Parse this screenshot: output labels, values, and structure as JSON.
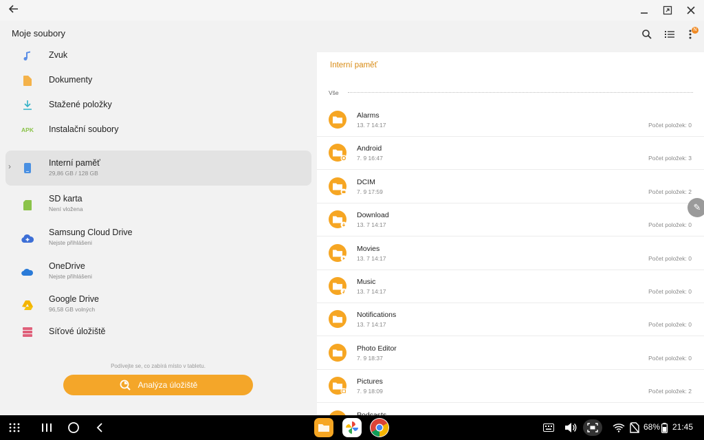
{
  "titlebar": {
    "back_icon": "arrow-left-icon",
    "minimize_icon": "minimize-icon",
    "resize_icon": "resize-icon",
    "close_icon": "close-icon"
  },
  "appbar": {
    "title": "Moje soubory",
    "badge": "N"
  },
  "sidebar": {
    "items": [
      {
        "label": "Zvuk",
        "sub": "",
        "icon": "music-note-icon",
        "color": "#5b8ee6"
      },
      {
        "label": "Dokumenty",
        "sub": "",
        "icon": "document-icon",
        "color": "#f4b24a"
      },
      {
        "label": "Stažené položky",
        "sub": "",
        "icon": "download-icon",
        "color": "#33b1c7"
      },
      {
        "label": "Instalační soubory",
        "sub": "",
        "icon": "apk-icon",
        "icon_text": "APK",
        "color": "#8bc34a"
      },
      {
        "label": "Interní paměť",
        "sub": "29,86 GB / 128 GB",
        "icon": "phone-icon",
        "color": "#4a90e2"
      },
      {
        "label": "SD karta",
        "sub": "Není vložena",
        "icon": "sd-card-icon",
        "color": "#8bc34a"
      },
      {
        "label": "Samsung Cloud Drive",
        "sub": "Nejste přihlášeni",
        "icon": "cloud-icon",
        "color": "#3d6fd6"
      },
      {
        "label": "OneDrive",
        "sub": "Nejste přihlášeni",
        "icon": "onedrive-icon",
        "color": "#2b7bd8"
      },
      {
        "label": "Google Drive",
        "sub": "96,58 GB volných",
        "icon": "google-drive-icon",
        "color": "#f4b400"
      },
      {
        "label": "Síťové úložiště",
        "sub": "",
        "icon": "server-icon",
        "color": "#e0607a"
      }
    ],
    "hint": "Podívejte se, co zabírá místo v tabletu.",
    "analyze_label": "Analýza úložiště"
  },
  "panel": {
    "title": "Interní paměť",
    "section": "Vše",
    "folders": [
      {
        "name": "Alarms",
        "date": "13. 7 14:17",
        "count": "Počet položek: 0",
        "overlay": ""
      },
      {
        "name": "Android",
        "date": "7. 9 16:47",
        "count": "Počet položek: 3",
        "overlay": "gear"
      },
      {
        "name": "DCIM",
        "date": "7. 9 17:59",
        "count": "Počet položek: 2",
        "overlay": "camera"
      },
      {
        "name": "Download",
        "date": "13. 7 14:17",
        "count": "Počet položek: 0",
        "overlay": "download"
      },
      {
        "name": "Movies",
        "date": "13. 7 14:17",
        "count": "Počet položek: 0",
        "overlay": "play"
      },
      {
        "name": "Music",
        "date": "13. 7 14:17",
        "count": "Počet položek: 0",
        "overlay": "music"
      },
      {
        "name": "Notifications",
        "date": "13. 7 14:17",
        "count": "Počet položek: 0",
        "overlay": ""
      },
      {
        "name": "Photo Editor",
        "date": "7. 9 18:37",
        "count": "Počet položek: 0",
        "overlay": ""
      },
      {
        "name": "Pictures",
        "date": "7. 9 18:09",
        "count": "Počet položek: 2",
        "overlay": "image"
      },
      {
        "name": "Podcasts",
        "date": "",
        "count": "",
        "overlay": ""
      }
    ]
  },
  "navbar": {
    "battery": "68%",
    "time": "21:45"
  },
  "colors": {
    "accent": "#f4a629",
    "folder": "#f6a623",
    "panel_title": "#d88a12"
  }
}
